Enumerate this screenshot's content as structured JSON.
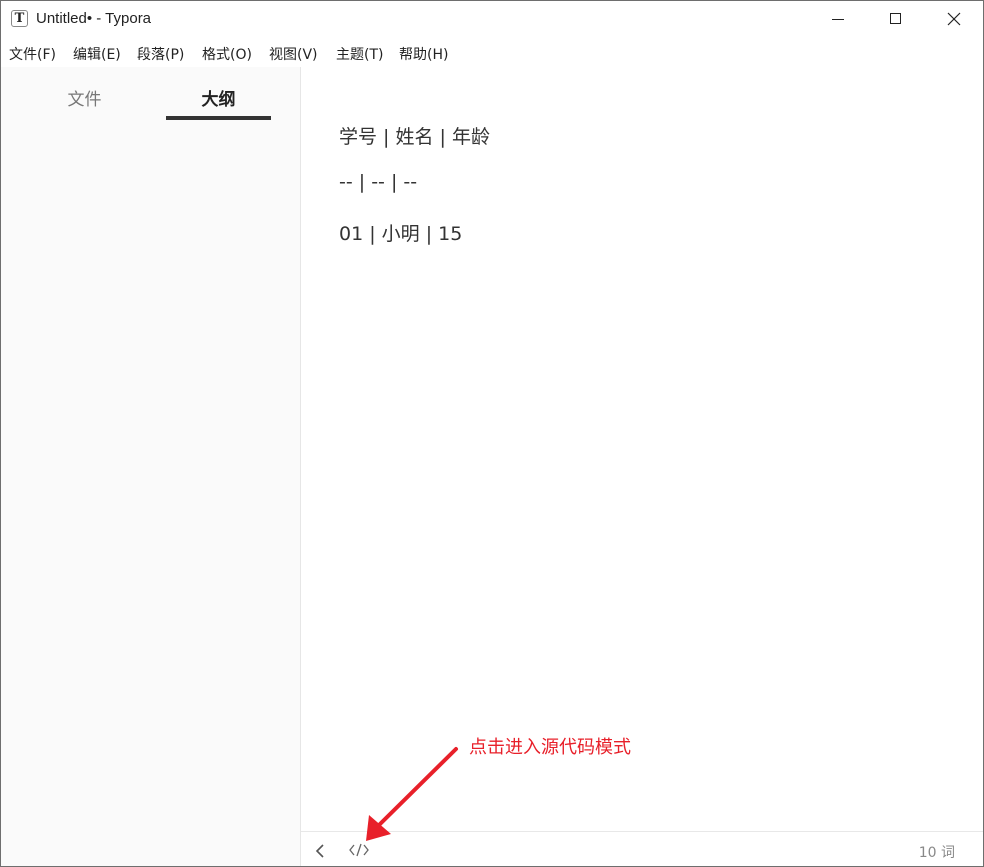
{
  "window": {
    "title": "Untitled• - Typora",
    "app_icon_letter": "T"
  },
  "menubar": {
    "items": [
      "文件(F)",
      "编辑(E)",
      "段落(P)",
      "格式(O)",
      "视图(V)",
      "主题(T)",
      "帮助(H)"
    ]
  },
  "sidebar": {
    "tabs": [
      {
        "label": "文件",
        "active": false
      },
      {
        "label": "大纲",
        "active": true
      }
    ]
  },
  "editor": {
    "lines": [
      "学号 | 姓名 | 年龄",
      "-- | -- | --",
      "01 | 小明 | 15"
    ]
  },
  "statusbar": {
    "word_count": "10 词"
  },
  "annotation": {
    "text": "点击进入源代码模式",
    "color": "#e8202a"
  },
  "icons": [
    "app-icon",
    "minimize-icon",
    "maximize-icon",
    "close-icon",
    "back-icon",
    "source-code-icon"
  ]
}
